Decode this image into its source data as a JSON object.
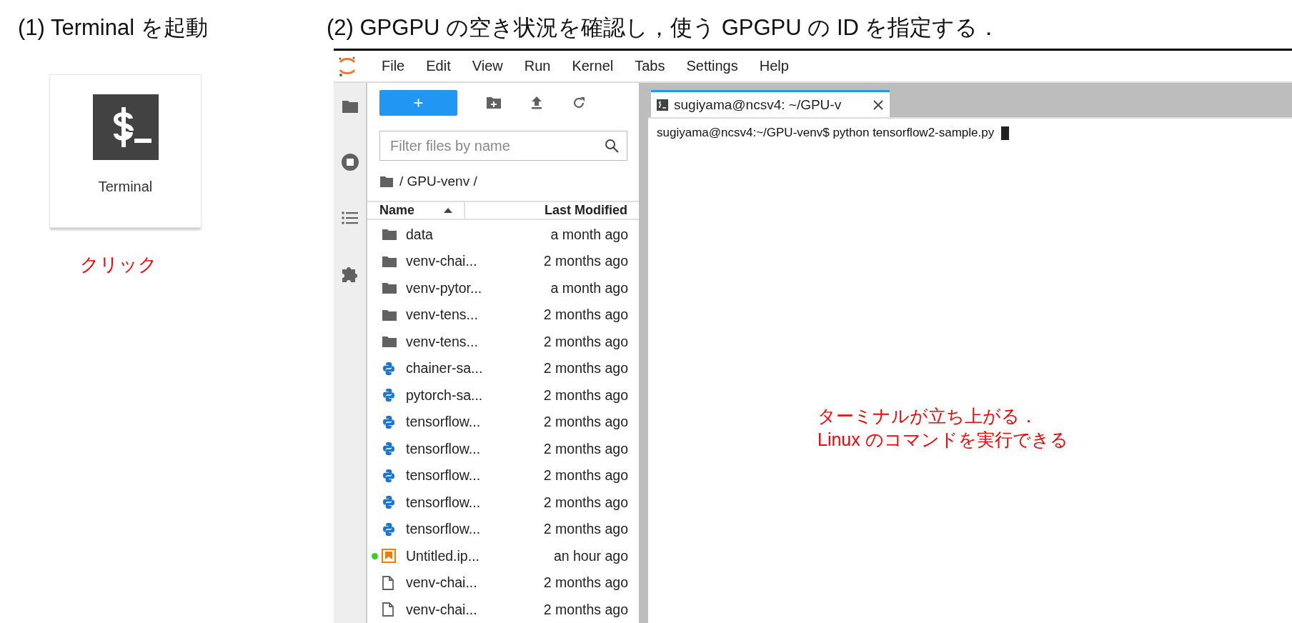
{
  "step1": {
    "heading": "(1) Terminal を起動",
    "launcher_label": "Terminal",
    "note": "クリック"
  },
  "step2": {
    "heading": "(2) GPGPU の空き状況を確認し，使う GPGPU の ID を指定する．"
  },
  "menu": [
    "File",
    "Edit",
    "View",
    "Run",
    "Kernel",
    "Tabs",
    "Settings",
    "Help"
  ],
  "file_browser": {
    "new_button": "+",
    "filter_placeholder": "Filter files by name",
    "path": "/ GPU-venv /",
    "columns": [
      {
        "label": "Name",
        "sorted": true
      },
      {
        "label": "Last Modified",
        "sorted": false
      }
    ],
    "files": [
      {
        "name": "data",
        "modified": "a month ago",
        "kind": "folder",
        "running": false
      },
      {
        "name": "venv-chai...",
        "modified": "2 months ago",
        "kind": "folder",
        "running": false
      },
      {
        "name": "venv-pytor...",
        "modified": "a month ago",
        "kind": "folder",
        "running": false
      },
      {
        "name": "venv-tens...",
        "modified": "2 months ago",
        "kind": "folder",
        "running": false
      },
      {
        "name": "venv-tens...",
        "modified": "2 months ago",
        "kind": "folder",
        "running": false
      },
      {
        "name": "chainer-sa...",
        "modified": "2 months ago",
        "kind": "python",
        "running": false
      },
      {
        "name": "pytorch-sa...",
        "modified": "2 months ago",
        "kind": "python",
        "running": false
      },
      {
        "name": "tensorflow...",
        "modified": "2 months ago",
        "kind": "python",
        "running": false
      },
      {
        "name": "tensorflow...",
        "modified": "2 months ago",
        "kind": "python",
        "running": false
      },
      {
        "name": "tensorflow...",
        "modified": "2 months ago",
        "kind": "python",
        "running": false
      },
      {
        "name": "tensorflow...",
        "modified": "2 months ago",
        "kind": "python",
        "running": false
      },
      {
        "name": "tensorflow...",
        "modified": "2 months ago",
        "kind": "python",
        "running": false
      },
      {
        "name": "Untitled.ip...",
        "modified": "an hour ago",
        "kind": "notebook",
        "running": true
      },
      {
        "name": "venv-chai...",
        "modified": "2 months ago",
        "kind": "file",
        "running": false
      },
      {
        "name": "venv-chai...",
        "modified": "2 months ago",
        "kind": "file",
        "running": false
      }
    ]
  },
  "terminal": {
    "tab_title": "sugiyama@ncsv4: ~/GPU-v",
    "command_line": "sugiyama@ncsv4:~/GPU-venv$ python tensorflow2-sample.py",
    "note": [
      "ターミナルが立ち上がる．",
      "Linux のコマンドを実行できる"
    ]
  }
}
